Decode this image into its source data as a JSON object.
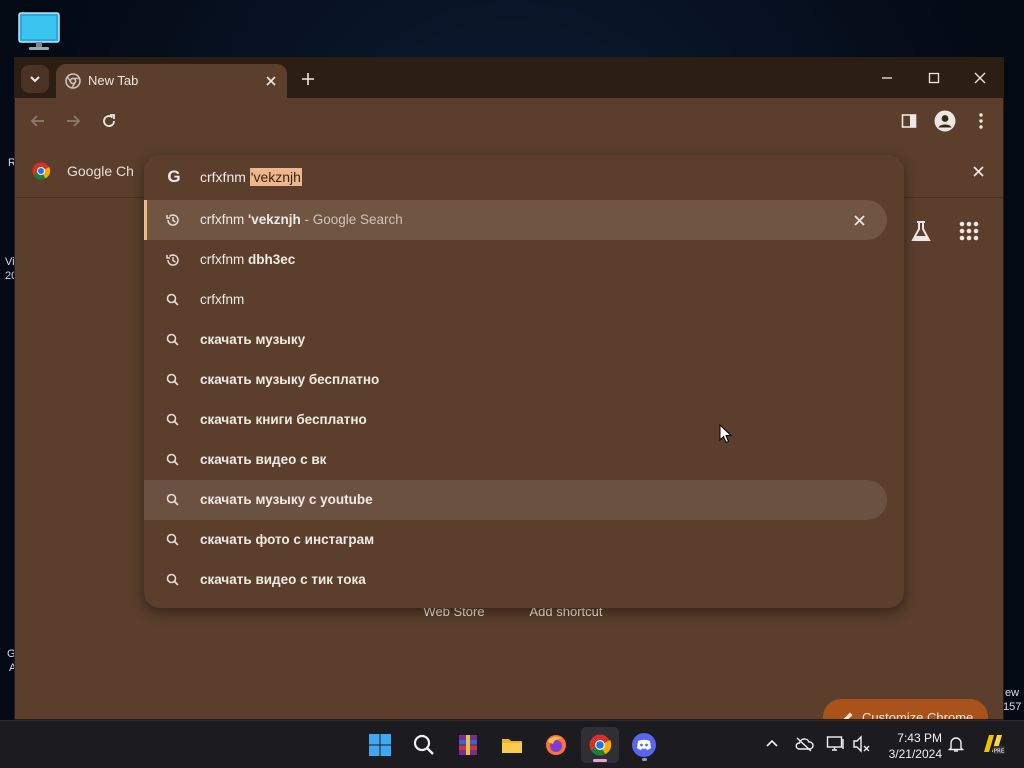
{
  "desktop": {
    "fragments": [
      "R",
      "Vi",
      "20",
      "G",
      "A",
      "ew",
      "157"
    ]
  },
  "tab": {
    "title": "New Tab"
  },
  "infobar": {
    "text": "Google Ch"
  },
  "omnibox": {
    "typed": "crfxfnm ",
    "selected_completion": "'vekznjh",
    "suggestions": [
      {
        "icon": "history-icon",
        "plain": "crfxfnm ",
        "bold": "'vekznjh",
        "suffix": " - Google Search",
        "state": "selected"
      },
      {
        "icon": "history-icon",
        "plain": "crfxfnm ",
        "bold": "dbh3ec",
        "suffix": "",
        "state": ""
      },
      {
        "icon": "search-icon",
        "plain": "crfxfnm",
        "bold": "",
        "suffix": "",
        "state": ""
      },
      {
        "icon": "search-icon",
        "plain": "",
        "bold": "скачать музыку",
        "suffix": "",
        "state": ""
      },
      {
        "icon": "search-icon",
        "plain": "",
        "bold": "скачать музыку бесплатно",
        "suffix": "",
        "state": ""
      },
      {
        "icon": "search-icon",
        "plain": "",
        "bold": "скачать книги бесплатно",
        "suffix": "",
        "state": ""
      },
      {
        "icon": "search-icon",
        "plain": "",
        "bold": "скачать видео с вк",
        "suffix": "",
        "state": ""
      },
      {
        "icon": "search-icon",
        "plain": "",
        "bold": "скачать музыку с youtube",
        "suffix": "",
        "state": "hover"
      },
      {
        "icon": "search-icon",
        "plain": "",
        "bold": "скачать фото с инстаграм",
        "suffix": "",
        "state": ""
      },
      {
        "icon": "search-icon",
        "plain": "",
        "bold": "скачать видео с тик тока",
        "suffix": "",
        "state": ""
      }
    ]
  },
  "shortcuts": [
    {
      "label": "Web Store"
    },
    {
      "label": "Add shortcut"
    }
  ],
  "customize": {
    "label": "Customize Chrome"
  },
  "clock": {
    "time": "7:43 PM",
    "date": "3/21/2024"
  },
  "colors": {
    "frame": "#2d1e14",
    "surface": "#5b3f2c",
    "accent": "#f0b78d",
    "customize_bg": "#a9531b"
  }
}
